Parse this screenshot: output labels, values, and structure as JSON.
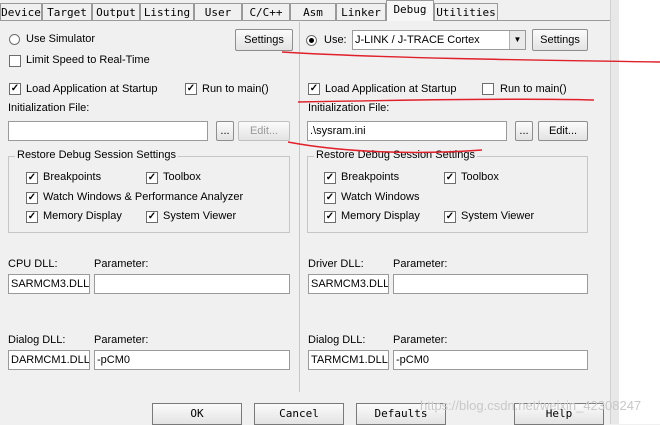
{
  "tabs": [
    "Device",
    "Target",
    "Output",
    "Listing",
    "User",
    "C/C++",
    "Asm",
    "Linker",
    "Debug",
    "Utilities"
  ],
  "left": {
    "use_simulator_label": "Use Simulator",
    "limit_speed_label": "Limit Speed to Real-Time",
    "settings_label": "Settings",
    "load_app_label": "Load Application at Startup",
    "run_to_main_label": "Run to main()",
    "init_file_label": "Initialization File:",
    "init_file_value": "",
    "browse_label": "...",
    "edit_label": "Edit...",
    "restore_group_label": "Restore Debug Session Settings",
    "breakpoints_label": "Breakpoints",
    "toolbox_label": "Toolbox",
    "watch_label": "Watch Windows & Performance Analyzer",
    "memory_label": "Memory Display",
    "sysviewer_label": "System Viewer",
    "cpu_dll_label": "CPU DLL:",
    "cpu_dll_value": "SARMCM3.DLL",
    "cpu_param_label": "Parameter:",
    "cpu_param_value": "",
    "dialog_dll_label": "Dialog DLL:",
    "dialog_dll_value": "DARMCM1.DLL",
    "dialog_param_label": "Parameter:",
    "dialog_param_value": "-pCM0"
  },
  "right": {
    "use_label": "Use:",
    "debugger_value": "J-LINK / J-TRACE Cortex",
    "settings_label": "Settings",
    "load_app_label": "Load Application at Startup",
    "run_to_main_label": "Run to main()",
    "init_file_label": "Initialization File:",
    "init_file_value": ".\\sysram.ini",
    "browse_label": "...",
    "edit_label": "Edit...",
    "restore_group_label": "Restore Debug Session Settings",
    "breakpoints_label": "Breakpoints",
    "toolbox_label": "Toolbox",
    "watch_label": "Watch Windows",
    "memory_label": "Memory Display",
    "sysviewer_label": "System Viewer",
    "driver_dll_label": "Driver DLL:",
    "driver_dll_value": "SARMCM3.DLL",
    "driver_param_label": "Parameter:",
    "driver_param_value": "",
    "dialog_dll_label": "Dialog DLL:",
    "dialog_dll_value": "TARMCM1.DLL",
    "dialog_param_label": "Parameter:",
    "dialog_param_value": "-pCM0"
  },
  "buttons": {
    "ok": "OK",
    "cancel": "Cancel",
    "defaults": "Defaults",
    "help": "Help"
  },
  "watermark": "https://blog.csdn.net/weixin_42308247",
  "colors": {
    "annotation_red": "#e0202a",
    "dialog_bg": "#f0f0f0"
  }
}
